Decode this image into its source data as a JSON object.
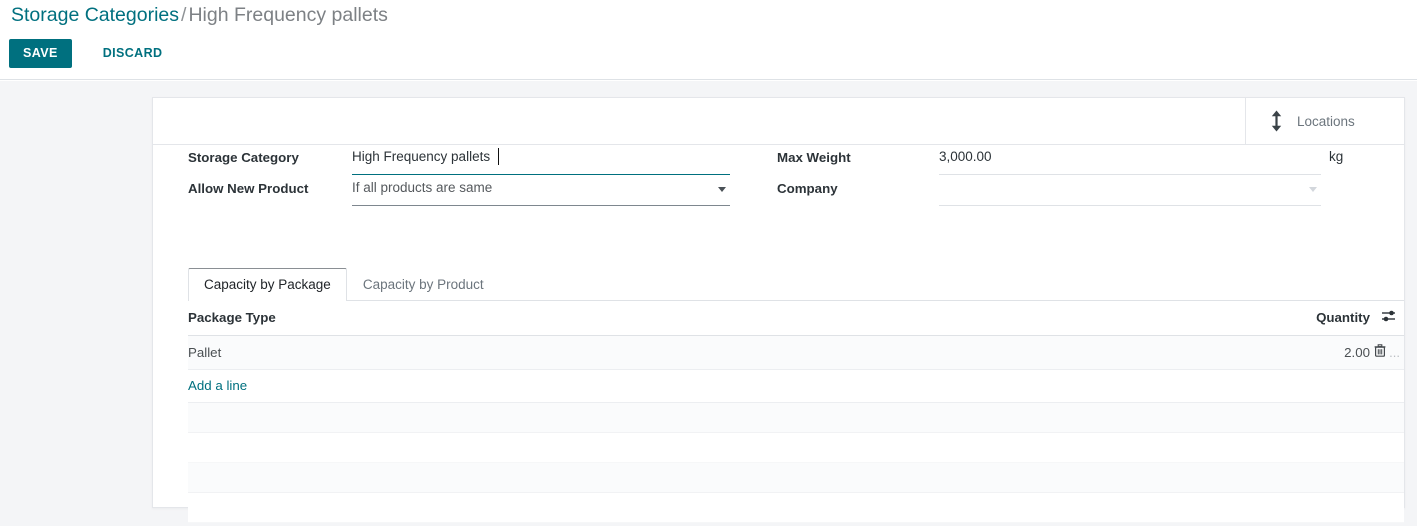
{
  "breadcrumb": {
    "root": "Storage Categories",
    "separator": "/",
    "current": "High Frequency pallets"
  },
  "actions": {
    "save_label": "SAVE",
    "discard_label": "DISCARD",
    "save_color": "#00707f",
    "link_color": "#00707f"
  },
  "smart_buttons": [
    {
      "icon": "arrows-vertical-icon",
      "label": "Locations"
    }
  ],
  "form": {
    "left": [
      {
        "label": "Storage Category",
        "value": "High Frequency pallets",
        "type": "text",
        "focused": true
      },
      {
        "label": "Allow New Product",
        "value": "If all products are same",
        "type": "select",
        "focused": false
      }
    ],
    "right": [
      {
        "label": "Max Weight",
        "value": "3,000.00",
        "type": "float",
        "suffix": "kg"
      },
      {
        "label": "Company",
        "value": "",
        "type": "many2one",
        "suffix": ""
      }
    ]
  },
  "notebook": {
    "tabs": [
      {
        "label": "Capacity by Package",
        "active": true
      },
      {
        "label": "Capacity by Product",
        "active": false
      }
    ]
  },
  "list": {
    "columns": [
      {
        "label": "Package Type",
        "align": "left"
      },
      {
        "label": "Quantity",
        "align": "right"
      }
    ],
    "optional_columns_icon": "sliders-icon",
    "rows": [
      {
        "package_type": "Pallet",
        "quantity": "2.00",
        "delete_icon": "trash-icon",
        "overflow": "..."
      }
    ],
    "add_line_label": "Add a line"
  }
}
